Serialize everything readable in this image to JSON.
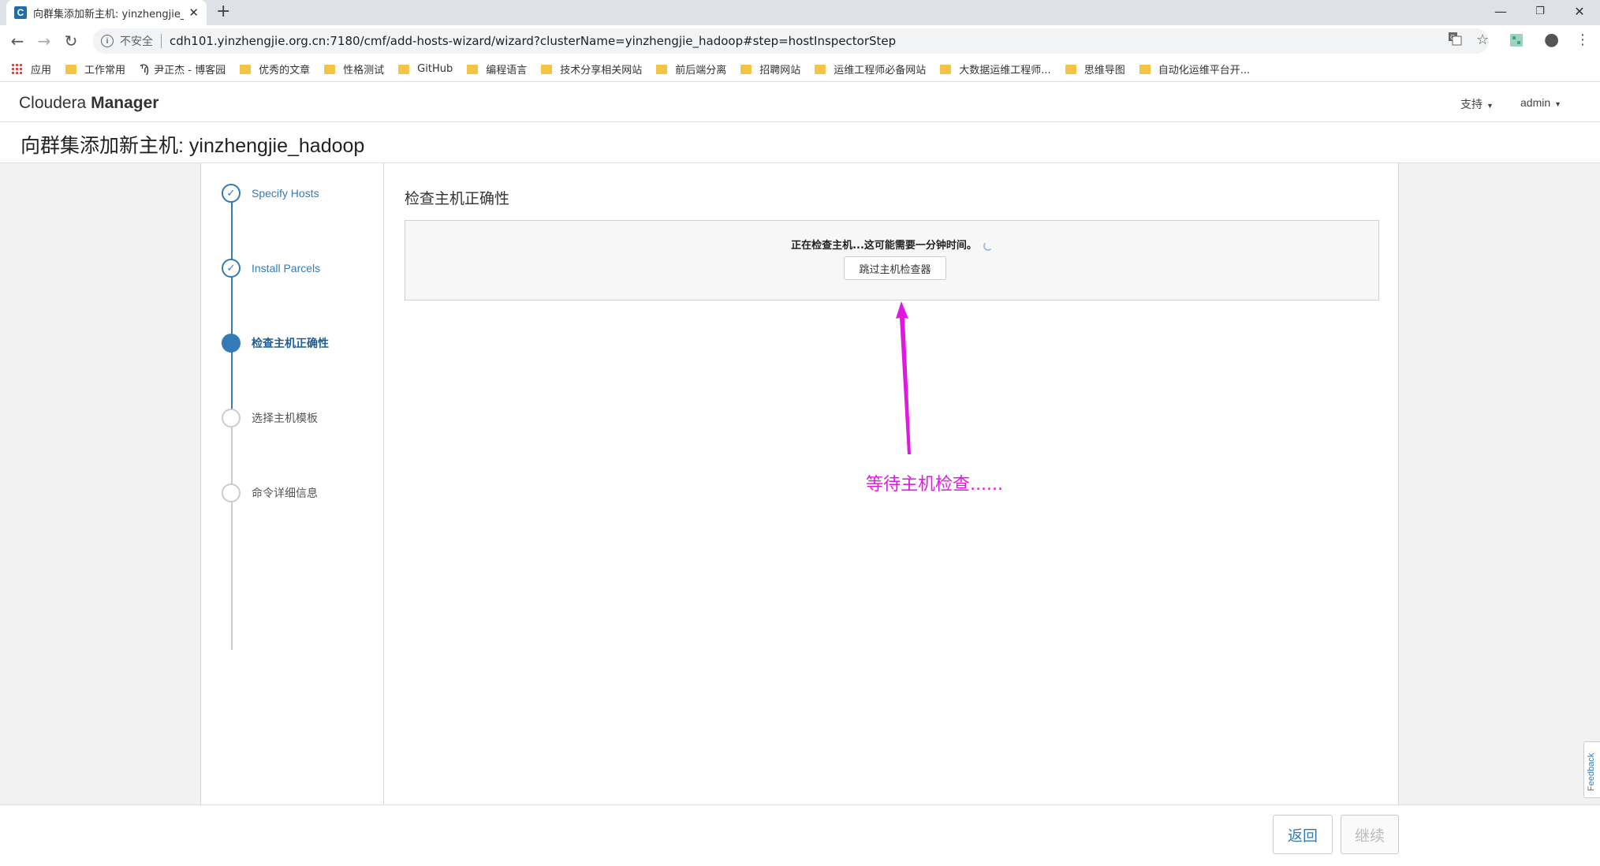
{
  "browser": {
    "tab_title": "向群集添加新主机: yinzhengjie_",
    "tab_close": "✕",
    "new_tab": "+",
    "favicon_letter": "C",
    "window_controls": {
      "minimize": "—",
      "maximize": "❐",
      "close": "✕"
    },
    "nav": {
      "back": "←",
      "forward": "→",
      "reload": "↻"
    },
    "security_icon": "i",
    "security_label": "不安全",
    "url": "cdh101.yinzhengjie.org.cn:7180/cmf/add-hosts-wizard/wizard?clusterName=yinzhengjie_hadoop#step=hostInspectorStep",
    "bookmarks": [
      {
        "icon": "apps-icon",
        "label": "应用"
      },
      {
        "icon": "folder-icon",
        "label": "工作常用"
      },
      {
        "icon": "wiki-icon",
        "label": "尹正杰 - 博客园"
      },
      {
        "icon": "folder-icon",
        "label": "优秀的文章"
      },
      {
        "icon": "folder-icon",
        "label": "性格测试"
      },
      {
        "icon": "folder-icon",
        "label": "GitHub"
      },
      {
        "icon": "folder-icon",
        "label": "编程语言"
      },
      {
        "icon": "folder-icon",
        "label": "技术分享相关网站"
      },
      {
        "icon": "folder-icon",
        "label": "前后端分离"
      },
      {
        "icon": "folder-icon",
        "label": "招聘网站"
      },
      {
        "icon": "folder-icon",
        "label": "运维工程师必备网站"
      },
      {
        "icon": "folder-icon",
        "label": "大数据运维工程师..."
      },
      {
        "icon": "folder-icon",
        "label": "思维导图"
      },
      {
        "icon": "folder-icon",
        "label": "自动化运维平台开..."
      }
    ]
  },
  "header": {
    "logo_light": "Cloudera",
    "logo_bold": "Manager",
    "support_label": "支持",
    "user_label": "admin"
  },
  "page": {
    "title": "向群集添加新主机: yinzhengjie_hadoop"
  },
  "wizard": {
    "steps": [
      {
        "label": "Specify Hosts",
        "state": "done"
      },
      {
        "label": "Install Parcels",
        "state": "done"
      },
      {
        "label": "检查主机正确性",
        "state": "active"
      },
      {
        "label": "选择主机模板",
        "state": "pending"
      },
      {
        "label": "命令详细信息",
        "state": "pending"
      }
    ],
    "content_title": "检查主机正确性",
    "checking_message": "正在检查主机...这可能需要一分钟时间。",
    "skip_button": "跳过主机检查器"
  },
  "annotation": {
    "text": "等待主机检查......",
    "color": "#e019e0"
  },
  "footer": {
    "back_button": "返回",
    "continue_button": "继续"
  },
  "feedback_label": "Feedback",
  "colors": {
    "accent": "#337ab7",
    "annotation": "#e019e0"
  }
}
